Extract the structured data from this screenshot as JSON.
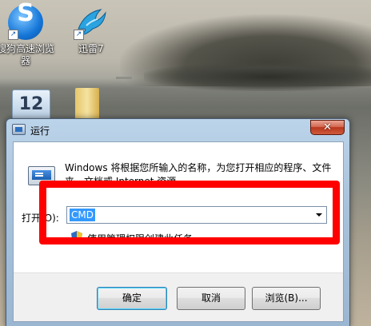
{
  "desktop": {
    "icons": [
      {
        "label": "搜狗高速浏览器",
        "icon": "sogou-browser-icon"
      },
      {
        "label": "迅雷7",
        "icon": "thunder-bird-icon"
      }
    ],
    "calendar_day": "12"
  },
  "dialog": {
    "title": "运行",
    "close_symbol": "✕",
    "description": "Windows 将根据您所输入的名称，为您打开相应的程序、文件夹、文档或 Internet 资源。",
    "open_label": "打开(O):",
    "input_value": "CMD",
    "admin_note": "使用管理权限创建此任务。",
    "buttons": {
      "ok": "确定",
      "cancel": "取消",
      "browse": "浏览(B)..."
    }
  },
  "colors": {
    "highlight": "#ff0000",
    "selection": "#3399ff"
  }
}
